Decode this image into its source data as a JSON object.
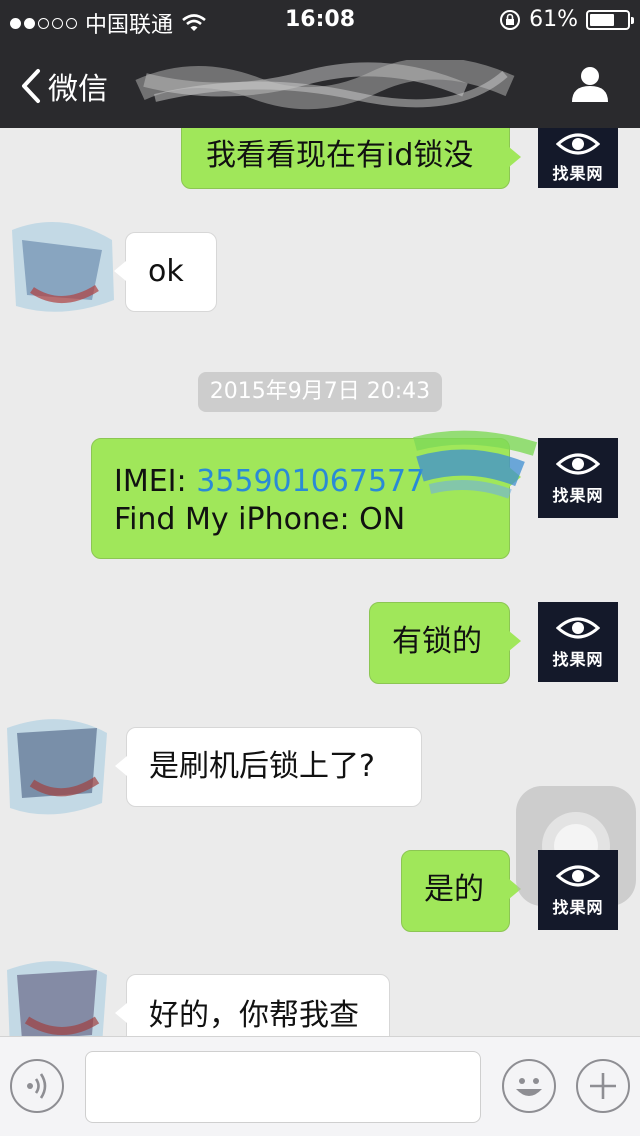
{
  "status_bar": {
    "carrier": "中国联通",
    "time": "16:08",
    "battery": "61%",
    "battery_level": 0.61,
    "signal_filled": 2,
    "signal_total": 5
  },
  "nav": {
    "back_label": "微信",
    "back_icon": "chevron-left-icon",
    "profile_icon": "person-icon"
  },
  "avatars": {
    "me_label": "找果网",
    "me_icon": "eye-icon"
  },
  "messages": [
    {
      "from": "me",
      "text": "我看看现在有id锁没"
    },
    {
      "from": "other",
      "text": "ok"
    },
    {
      "type": "timestamp",
      "text": "2015年9月7日 20:43"
    },
    {
      "from": "me",
      "imei_label": "IMEI: ",
      "imei_value": "355901067577",
      "fmi": "Find My iPhone: ON"
    },
    {
      "from": "me",
      "text": "有锁的"
    },
    {
      "from": "other",
      "text": "是刷机后锁上了?"
    },
    {
      "from": "me",
      "text": "是的"
    },
    {
      "from": "other",
      "text": "好的，你帮我查"
    }
  ],
  "input_bar": {
    "voice_icon": "voice-icon",
    "emoji_icon": "emoji-icon",
    "plus_icon": "plus-icon",
    "input_value": ""
  },
  "colors": {
    "bar": "#2a2a2d",
    "chat_bg": "#ebebeb",
    "sent_bubble": "#a0e75a",
    "received_bubble": "#ffffff",
    "imei_link": "#2a8ad6"
  }
}
